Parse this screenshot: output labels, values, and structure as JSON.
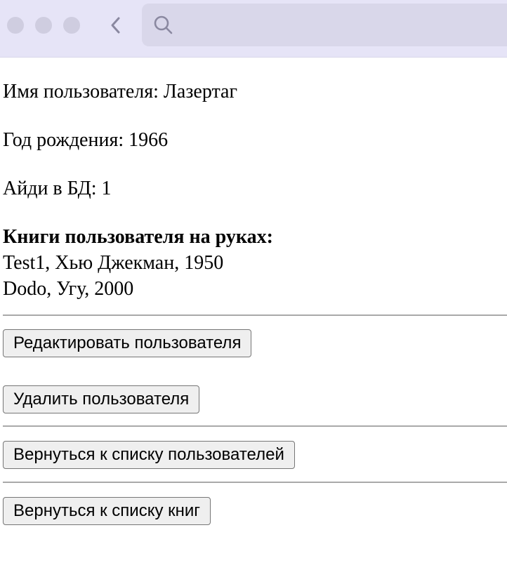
{
  "browser": {
    "back_icon": "chevron-left-icon",
    "search_icon": "search-icon",
    "address_value": ""
  },
  "user": {
    "name_line": "Имя пользователя: Лазертаг",
    "birth_line": "Год рождения: 1966",
    "id_line": "Айди в БД: 1",
    "books_heading": "Книги пользователя на руках:",
    "books": [
      "Test1, Хью Джекман, 1950",
      "Dodo, Угу, 2000"
    ]
  },
  "actions": {
    "edit_label": "Редактировать пользователя",
    "delete_label": "Удалить пользователя",
    "back_to_users_label": "Вернуться к списку пользователей",
    "back_to_books_label": "Вернуться к списку книг"
  }
}
